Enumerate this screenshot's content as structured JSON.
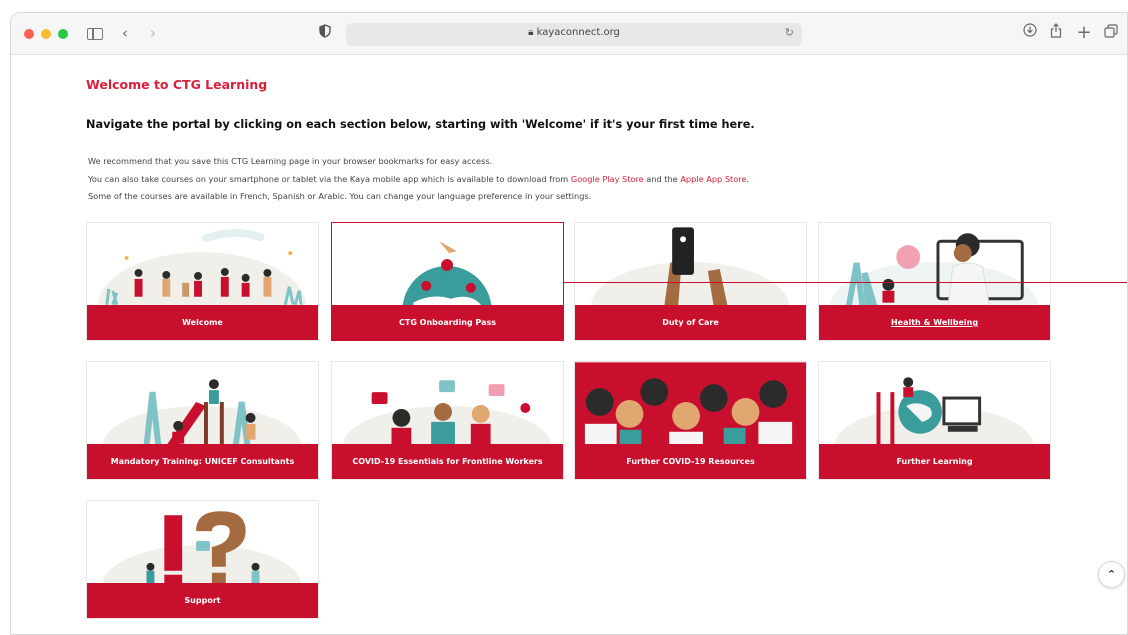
{
  "browser": {
    "url": "kayaconnect.org",
    "icons": {
      "back": "chevron-left-icon",
      "forward": "chevron-right-icon",
      "privacy": "shield-icon",
      "lock": "lock-icon",
      "reload": "reload-icon",
      "download": "download-icon",
      "share": "share-icon",
      "new_tab": "plus-icon",
      "tab_overview": "tabs-icon"
    }
  },
  "page": {
    "title": "Welcome to CTG Learning",
    "heading": "Navigate the portal by clicking on each section below, starting with 'Welcome' if it's your first time here.",
    "info_line1": "We recommend that you save this CTG Learning page in your browser bookmarks for easy access.",
    "info_line2_a": "You can also take courses on your smartphone or tablet via the Kaya mobile app which is available to download from ",
    "info_line2_link1": "Google Play Store",
    "info_line2_b": " and the ",
    "info_line2_link2": "Apple App Store",
    "info_line2_c": ".",
    "info_line3": "Some of the courses are available in French, Spanish or Arabic. You can change your language preference in your settings."
  },
  "cards": [
    {
      "label": "Welcome"
    },
    {
      "label": "CTG Onboarding Pass"
    },
    {
      "label": "Duty of Care"
    },
    {
      "label": "Health & Wellbeing"
    },
    {
      "label": "Mandatory Training: UNICEF Consultants"
    },
    {
      "label": "COVID-19 Essentials for Frontline Workers"
    },
    {
      "label": "Further COVID-19 Resources"
    },
    {
      "label": "Further Learning"
    },
    {
      "label": "Support"
    }
  ],
  "colors": {
    "brand_red": "#c8102e",
    "title_red": "#d61f3a"
  }
}
